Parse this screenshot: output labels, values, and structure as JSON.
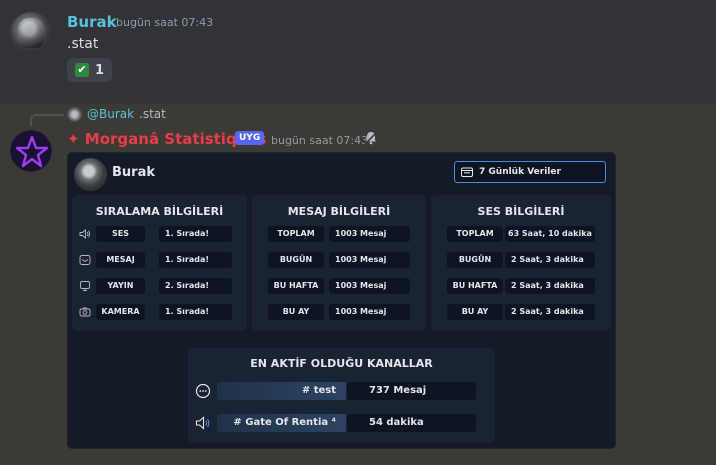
{
  "message1": {
    "username": "Burak",
    "timestamp": "bugün saat 07:43",
    "content": ".stat",
    "reaction": {
      "emoji": "white-check-mark",
      "count": "1"
    }
  },
  "message2": {
    "reply": {
      "mention": "@Burak",
      "text": ".stat"
    },
    "username": "✦ Morganâ Statistiques",
    "app_badge": "UYG",
    "timestamp": "bugün saat 07:43"
  },
  "embed": {
    "user": "Burak",
    "period_button": "7 Günlük Veriler",
    "ranking": {
      "title": "SIRALAMA BİLGİLERİ",
      "rows": [
        {
          "icon": "speaker-icon",
          "label": "SES",
          "value": "1. Sırada!"
        },
        {
          "icon": "envelope-icon",
          "label": "MESAJ",
          "value": "1. Sırada!"
        },
        {
          "icon": "monitor-icon",
          "label": "YAYIN",
          "value": "2. Sırada!"
        },
        {
          "icon": "camera-icon",
          "label": "KAMERA",
          "value": "1. Sırada!"
        }
      ]
    },
    "messages": {
      "title": "MESAJ BİLGİLERİ",
      "rows": [
        {
          "label": "TOPLAM",
          "value": "1003 Mesaj"
        },
        {
          "label": "BUGÜN",
          "value": "1003 Mesaj"
        },
        {
          "label": "BU HAFTA",
          "value": "1003 Mesaj"
        },
        {
          "label": "BU AY",
          "value": "1003 Mesaj"
        }
      ]
    },
    "voice": {
      "title": "SES BİLGİLERİ",
      "rows": [
        {
          "label": "TOPLAM",
          "value": "63 Saat, 10 dakika"
        },
        {
          "label": "BUGÜN",
          "value": "2 Saat, 3 dakika"
        },
        {
          "label": "BU HAFTA",
          "value": "2 Saat, 3 dakika"
        },
        {
          "label": "BU AY",
          "value": "2 Saat, 3 dakika"
        }
      ]
    },
    "channels": {
      "title": "EN AKTİF OLDUĞU KANALLAR",
      "rows": [
        {
          "icon": "chat-bubble-icon",
          "name": "# test",
          "value": "737 Mesaj"
        },
        {
          "icon": "speaker-icon",
          "name": "# Gate Of Rentia ⁴",
          "value": "54 dakika"
        }
      ]
    }
  },
  "colors": {
    "username_cyan": "#59c2d8",
    "bot_name_red": "#e83c4a",
    "app_badge": "#5865f2",
    "period_button_border": "#4d8ae0"
  }
}
